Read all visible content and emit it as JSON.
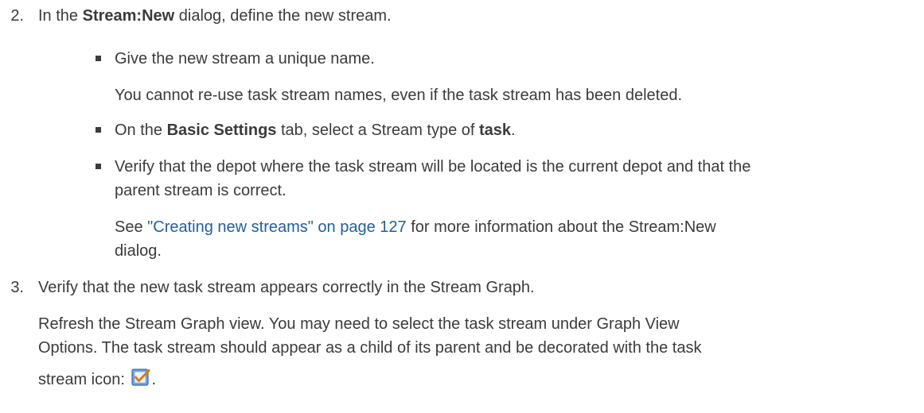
{
  "step2": {
    "number": "2.",
    "pre": "In the ",
    "bold": "Stream:New",
    "post": " dialog, define the new stream."
  },
  "bullets": [
    {
      "text": "Give the new stream a unique name."
    },
    {
      "pre": "On the ",
      "bold1": "Basic Settings",
      "mid": " tab, select a Stream type of ",
      "bold2": "task",
      "post": "."
    },
    {
      "line1": "Verify that the depot where the task stream will be located is the current depot and that the",
      "line2": "parent stream is correct."
    }
  ],
  "note_reuse": "You cannot re-use task stream names, even if the task stream has been deleted.",
  "see_ref": {
    "pre": "See ",
    "link": "\"Creating new streams\" on page 127",
    "post": " for more information about the Stream:New",
    "line2": "dialog."
  },
  "step3": {
    "number": "3.",
    "text": "Verify that the new task stream appears correctly in the Stream Graph."
  },
  "refresh_para": {
    "line1": "Refresh the Stream Graph view. You may need to select the task stream under Graph View",
    "line2": "Options. The task stream should appear as a child of its parent and be decorated with the task",
    "line3": "stream icon: ",
    "end": "."
  },
  "icon": "task-stream-icon"
}
